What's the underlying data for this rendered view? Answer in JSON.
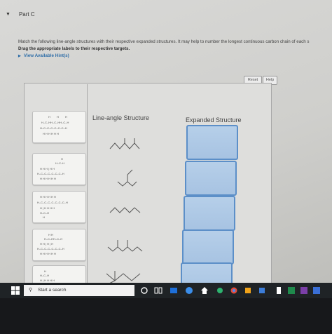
{
  "header": {
    "part_label": "Part C",
    "collapse_icon": "triangle-down-icon"
  },
  "instructions": {
    "text": "Match the following line-angle structures with their respective expanded structures. It may help to number the longest continuous carbon chain of each s",
    "drag_note": "Drag the appropriate labels to their respective targets.",
    "hints_link": "View Available Hint(s)"
  },
  "toolbar": {
    "reset_label": "Reset",
    "help_label": "Help"
  },
  "columns": {
    "line_angle": "Line-angle Structure",
    "expanded": "Expanded Structure"
  },
  "taskbar": {
    "search_placeholder": "Start a search",
    "search_icon": "magnifier-icon"
  },
  "colors": {
    "target_fill": "#a9c5e3",
    "target_border": "#5c8fc8",
    "link": "#2f6ea8"
  }
}
